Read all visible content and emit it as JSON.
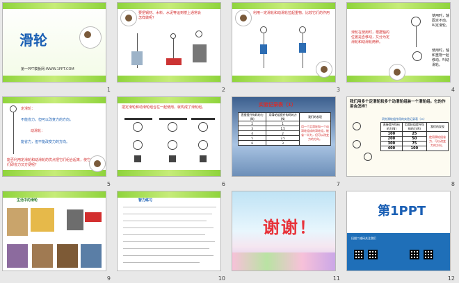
{
  "slides": [
    {
      "number": "1",
      "title": "滑轮",
      "subtitle": "第一PPT模板网-WWW.1PPT.COM"
    },
    {
      "number": "2",
      "text": "要把钢材、木料、水泥等运到楼上通常会怎样做呢？"
    },
    {
      "number": "3",
      "text": "利用一定滑轮和动滑轮拉起重物，比较它们的作用"
    },
    {
      "number": "4",
      "text1": "滑轮在使用时，根据轴的位置是否移动，又分为定滑轮和动滑轮两种。",
      "text2": "使用时，轴固定不动，叫定滑轮。",
      "text3": "使用时，轴和重物一起移动，叫动滑轮。"
    },
    {
      "number": "5",
      "text1": "定滑轮：",
      "text2": "不能省力，但可以改变力的方向。",
      "text3": "动滑轮：",
      "text4": "能省力，但不能改变力的方向。",
      "text5": "能否利用定滑轮和动滑轮的优点把它们组合起来，使它们即省力又方便呢？"
    },
    {
      "number": "6",
      "text": "把定滑轮和动滑轮组合在一起使用，就构成了滑轮组。"
    },
    {
      "number": "7",
      "title": "实验记录表（1）",
      "headers": [
        "直接提升钩码的力(N)",
        "用滑轮组提升钩码的力(N)",
        "我们的发现"
      ],
      "rows": [
        [
          "2",
          "1"
        ],
        [
          "3",
          "1.5"
        ],
        [
          "4",
          "2"
        ],
        [
          "5",
          "2.5"
        ],
        [
          "6",
          "3"
        ]
      ],
      "finding": "用一个定滑轮和一个动滑轮组成的滑轮组，能省一半力，但可以改变力的方向。"
    },
    {
      "number": "8",
      "question": "我们用多个定滑轮和多个动滑轮组装一个滑轮组。它的作用会怎样？",
      "table_title": "研究滑轮组作用的实验记录表（二）",
      "headers": [
        "直接提升钩码的力(N)",
        "用滑轮组提升钩码的力(N)",
        "我们的发现"
      ],
      "rows": [
        [
          "100",
          "25"
        ],
        [
          "200",
          "50"
        ],
        [
          "300",
          "75"
        ],
        [
          "400",
          "100"
        ]
      ],
      "finding": "使用滑轮组省力，可以改变力的方向。"
    },
    {
      "number": "9",
      "text": "生活中的滑轮"
    },
    {
      "number": "10",
      "title": "智力练习"
    },
    {
      "number": "11",
      "title": "谢谢！"
    },
    {
      "number": "12",
      "logo": "第1PPT",
      "footer": "扫描二维码关注我们"
    }
  ],
  "colors": {
    "accent": "#8fd43c",
    "title_blue": "#1a5fb4",
    "red": "#d32f2f"
  }
}
